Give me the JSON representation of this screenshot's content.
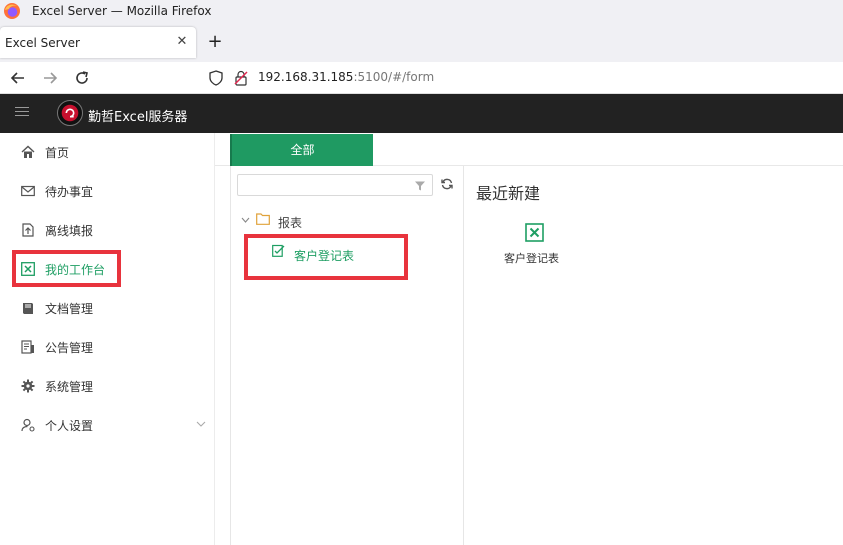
{
  "browser": {
    "window_title": "Excel Server — Mozilla Firefox",
    "tab_title": "Excel Server",
    "tab_close": "✕",
    "new_tab": "+",
    "url_host": "192.168.31.185",
    "url_rest": ":5100/#/form"
  },
  "app": {
    "name": "勤哲Excel服务器",
    "accent_color": "#1f9a62",
    "header_color": "#222222"
  },
  "sidebar": {
    "items": [
      {
        "label": "首页",
        "icon": "home-icon"
      },
      {
        "label": "待办事宜",
        "icon": "mail-icon"
      },
      {
        "label": "离线填报",
        "icon": "upload-doc-icon"
      },
      {
        "label": "我的工作台",
        "icon": "excel-icon",
        "active": true
      },
      {
        "label": "文档管理",
        "icon": "book-icon"
      },
      {
        "label": "公告管理",
        "icon": "notice-icon"
      },
      {
        "label": "系统管理",
        "icon": "gear-icon"
      },
      {
        "label": "个人设置",
        "icon": "user-settings-icon"
      }
    ]
  },
  "main": {
    "tab_label": "全部",
    "tree": {
      "folder_label": "报表",
      "file_label": "客户登记表"
    },
    "recent": {
      "title": "最近新建",
      "item_label": "客户登记表"
    }
  }
}
